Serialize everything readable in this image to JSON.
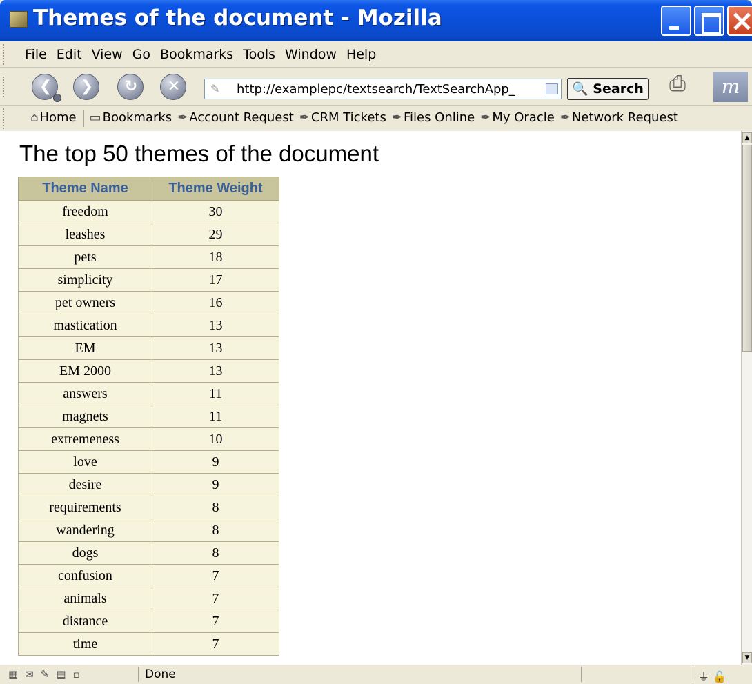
{
  "window": {
    "title": "Themes of the document - Mozilla"
  },
  "menu": {
    "items": [
      "File",
      "Edit",
      "View",
      "Go",
      "Bookmarks",
      "Tools",
      "Window",
      "Help"
    ]
  },
  "navigation": {
    "back_icon": "back-arrow-icon",
    "forward_icon": "forward-arrow-icon",
    "reload_icon": "reload-icon",
    "stop_icon": "stop-icon",
    "url": "http://examplepc/textsearch/TextSearchApp_",
    "search_label": "Search"
  },
  "bookmarks_bar": {
    "home": "Home",
    "bookmarks": "Bookmarks",
    "links": [
      "Account Request",
      "CRM Tickets",
      "Files Online",
      "My Oracle",
      "Network Request"
    ]
  },
  "page": {
    "heading": "The top 50 themes of the document",
    "table": {
      "headers": [
        "Theme Name",
        "Theme Weight"
      ],
      "rows": [
        [
          "freedom",
          "30"
        ],
        [
          "leashes",
          "29"
        ],
        [
          "pets",
          "18"
        ],
        [
          "simplicity",
          "17"
        ],
        [
          "pet owners",
          "16"
        ],
        [
          "mastication",
          "13"
        ],
        [
          "EM",
          "13"
        ],
        [
          "EM 2000",
          "13"
        ],
        [
          "answers",
          "11"
        ],
        [
          "magnets",
          "11"
        ],
        [
          "extremeness",
          "10"
        ],
        [
          "love",
          "9"
        ],
        [
          "desire",
          "9"
        ],
        [
          "requirements",
          "8"
        ],
        [
          "wandering",
          "8"
        ],
        [
          "dogs",
          "8"
        ],
        [
          "confusion",
          "7"
        ],
        [
          "animals",
          "7"
        ],
        [
          "distance",
          "7"
        ],
        [
          "time",
          "7"
        ]
      ]
    }
  },
  "status": {
    "text": "Done"
  },
  "colors": {
    "titlebar": "#0a4fd8",
    "table_header_bg": "#c8c49c",
    "table_header_text": "#3a5f9a",
    "table_body_bg": "#f7f4de"
  }
}
